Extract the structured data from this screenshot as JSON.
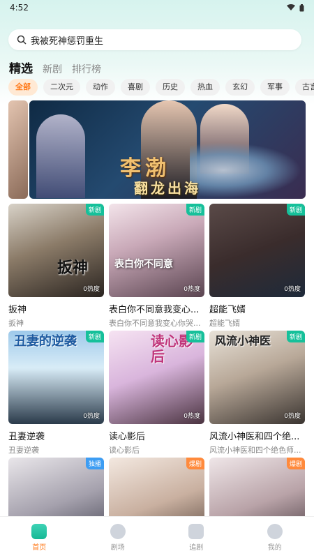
{
  "status": {
    "time": "4:52"
  },
  "search": {
    "query": "我被死神惩罚重生"
  },
  "tabs": [
    {
      "label": "精选",
      "active": true
    },
    {
      "label": "新剧",
      "active": false
    },
    {
      "label": "排行榜",
      "active": false
    }
  ],
  "chips": [
    "全部",
    "二次元",
    "动作",
    "喜剧",
    "历史",
    "热血",
    "玄幻",
    "军事",
    "古言"
  ],
  "banner": {
    "title": "李渤",
    "subtitle": "翻龙出海"
  },
  "cards": [
    {
      "title": "扳神",
      "subtitle": "扳神",
      "badge": "新剧",
      "heat": "0热度",
      "poster_text": "扳神"
    },
    {
      "title": "表白你不同意我变心...",
      "subtitle": "表白你不同意我变心你哭...",
      "badge": "新剧",
      "heat": "0热度",
      "poster_text": "表白你不同意"
    },
    {
      "title": "超能飞婿",
      "subtitle": "超能飞婿",
      "badge": "新剧",
      "heat": "0热度",
      "poster_text": ""
    },
    {
      "title": "丑妻逆袭",
      "subtitle": "丑妻逆袭",
      "badge": "新剧",
      "heat": "0热度",
      "poster_text": "丑妻的逆袭"
    },
    {
      "title": "读心影后",
      "subtitle": "读心影后",
      "badge": "新剧",
      "heat": "0热度",
      "poster_text": "读心影后"
    },
    {
      "title": "风流小神医和四个绝...",
      "subtitle": "风流小神医和四个绝色师...",
      "badge": "新剧",
      "heat": "0热度",
      "poster_text": "风流小神医"
    },
    {
      "title": "",
      "subtitle": "",
      "badge": "独播",
      "heat": "",
      "poster_text": ""
    },
    {
      "title": "",
      "subtitle": "",
      "badge": "爆剧",
      "heat": "",
      "poster_text": ""
    },
    {
      "title": "",
      "subtitle": "",
      "badge": "爆剧",
      "heat": "",
      "poster_text": ""
    }
  ],
  "nav": [
    {
      "label": "首页",
      "icon": "home-icon",
      "active": true
    },
    {
      "label": "剧场",
      "icon": "theater-icon",
      "active": false
    },
    {
      "label": "追剧",
      "icon": "play-icon",
      "active": false
    },
    {
      "label": "我的",
      "icon": "profile-icon",
      "active": false
    }
  ],
  "colors": {
    "accent": "#ff7a1a",
    "badge_new": "#16c09a",
    "badge_hot": "#ff8a3c",
    "badge_exclusive": "#3d9df3"
  }
}
